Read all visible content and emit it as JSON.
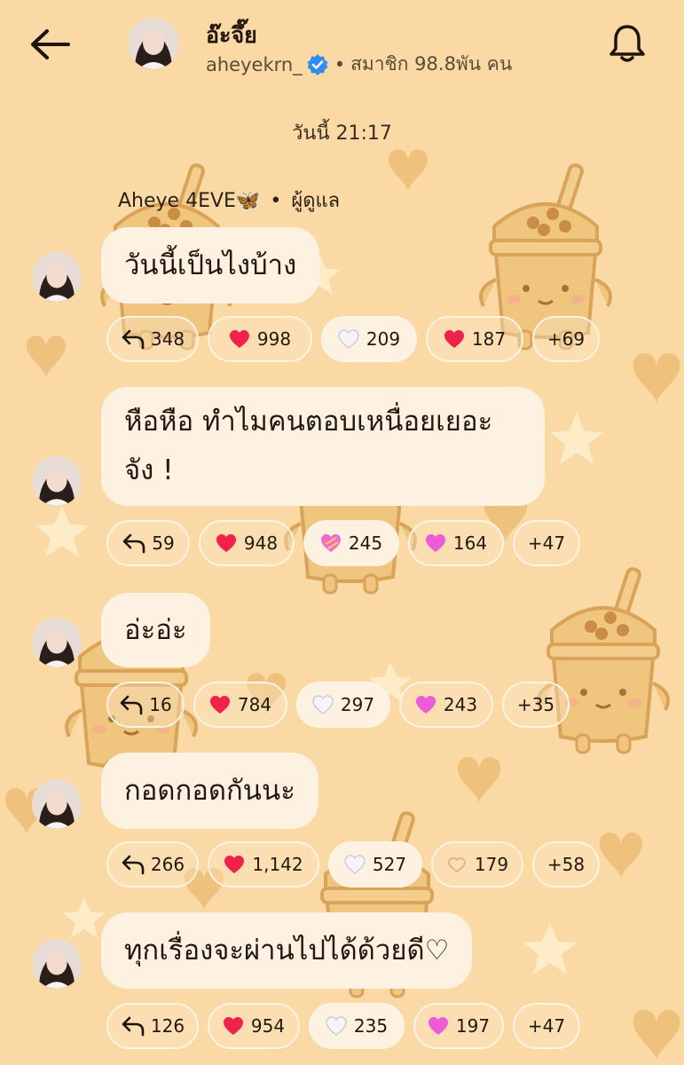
{
  "header": {
    "back_label": "back",
    "channel_name": "อ๊ะจึ๊ย",
    "handle": "aheyekrn_",
    "separator": "•",
    "members": "สมาชิก 98.8พัน คน"
  },
  "timestamp": "วันนี้ 21:17",
  "sender": {
    "name": "Aheye 4EVE🦋",
    "separator": "•",
    "role": "ผู้ดูแล"
  },
  "messages": [
    {
      "text": "วันนี้เป็นไงบ้าง",
      "reactions": [
        {
          "icon": "reply-icon",
          "count": "348"
        },
        {
          "icon": "red-heart-icon",
          "count": "998"
        },
        {
          "icon": "white-heart-icon",
          "count": "209"
        },
        {
          "icon": "red-heart-icon",
          "count": "187"
        },
        {
          "icon": "",
          "count": "+69"
        }
      ]
    },
    {
      "text_line1": "หือหือ ทำไมคนตอบเหนื่อยเยอะ",
      "text_line2": "จัง !",
      "reactions": [
        {
          "icon": "reply-icon",
          "count": "59"
        },
        {
          "icon": "red-heart-icon",
          "count": "948"
        },
        {
          "icon": "heart-with-ribbon-icon",
          "count": "245"
        },
        {
          "icon": "pink-heart-icon",
          "count": "164"
        },
        {
          "icon": "",
          "count": "+47"
        }
      ]
    },
    {
      "text": "อ่ะอ่ะ",
      "reactions": [
        {
          "icon": "reply-icon",
          "count": "16"
        },
        {
          "icon": "red-heart-icon",
          "count": "784"
        },
        {
          "icon": "white-heart-icon",
          "count": "297"
        },
        {
          "icon": "pink-heart-icon",
          "count": "243"
        },
        {
          "icon": "",
          "count": "+35"
        }
      ]
    },
    {
      "text": "กอดกอดกันนะ",
      "reactions": [
        {
          "icon": "reply-icon",
          "count": "266"
        },
        {
          "icon": "red-heart-icon",
          "count": "1,142"
        },
        {
          "icon": "white-heart-icon",
          "count": "527"
        },
        {
          "icon": "heart-hands-icon",
          "count": "179"
        },
        {
          "icon": "",
          "count": "+58"
        }
      ]
    },
    {
      "text": "ทุกเรื่องจะผ่านไปได้ด้วยดี♡",
      "reactions": [
        {
          "icon": "reply-icon",
          "count": "126"
        },
        {
          "icon": "red-heart-icon",
          "count": "954"
        },
        {
          "icon": "white-heart-icon",
          "count": "235"
        },
        {
          "icon": "pink-heart-icon",
          "count": "197"
        },
        {
          "icon": "",
          "count": "+47"
        }
      ]
    }
  ],
  "colors": {
    "background": "#fbd9a4",
    "bubble": "#fdf2e1",
    "decor": "#eec17d",
    "decor_outline": "#d9a45a",
    "red_heart": "#f0224a",
    "pink_heart": "#ee5bd8",
    "verified": "#2f8cf5"
  }
}
